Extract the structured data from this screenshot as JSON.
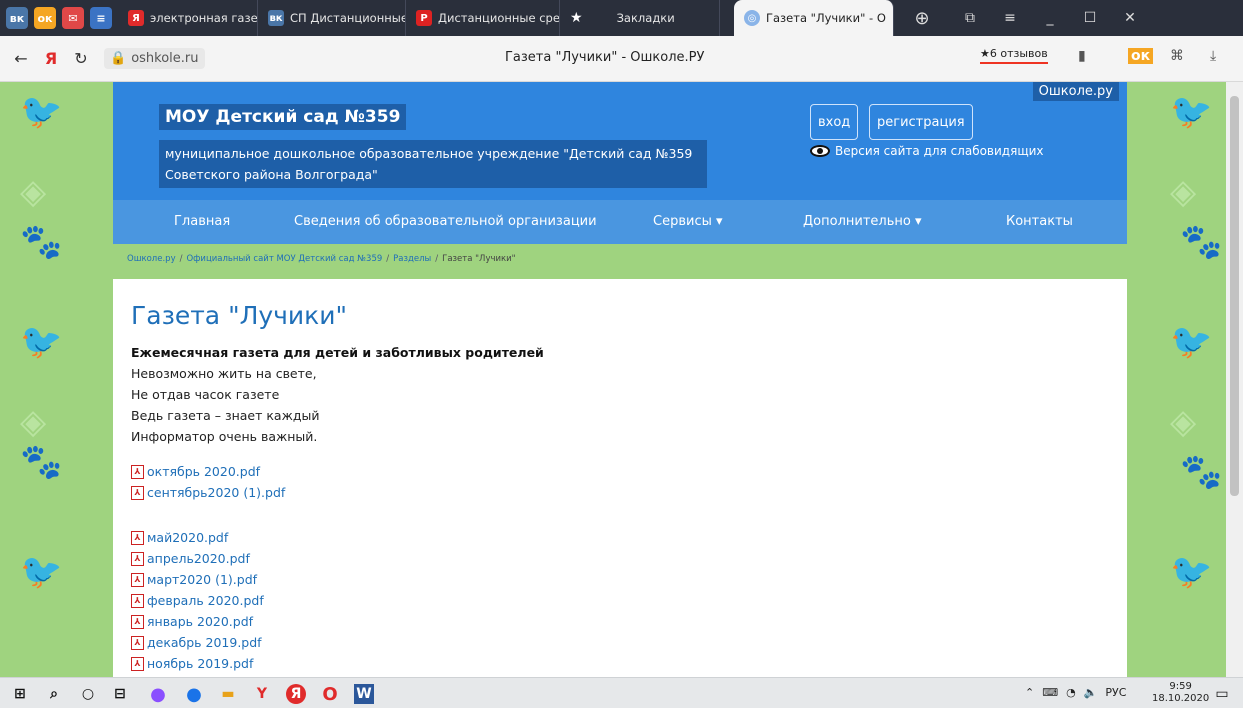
{
  "browser": {
    "tabs": [
      {
        "label": "электронная газета в д",
        "icon": "yandex-icon",
        "active": false
      },
      {
        "label": "СП Дистанционные фо",
        "icon": "vk-icon",
        "active": false
      },
      {
        "label": "Дистанционные средс",
        "icon": "pdf-icon",
        "active": false
      },
      {
        "label": "Закладки",
        "icon": "star-icon",
        "active": false
      },
      {
        "label": "Газета \"Лучики\" - О",
        "icon": "globe-icon",
        "active": true
      }
    ],
    "url": "oshkole.ru",
    "title": "Газета \"Лучики\" - Ошколе.РУ",
    "reviews": "★6 отзывов",
    "accent": "#2f85de"
  },
  "site": {
    "brand": "Ошколе.ру",
    "org_name": "МОУ Детский сад №359",
    "org_subtitle": "муниципальное дошкольное образовательное учреждение \"Детский сад №359 Советского района Волгограда\"",
    "login": "вход",
    "register": "регистрация",
    "low_vision": "Версия сайта для слабовидящих",
    "menu": [
      {
        "label": "Главная"
      },
      {
        "label": "Сведения об образовательной организации"
      },
      {
        "label": "Сервисы ▾"
      },
      {
        "label": "Дополнительно ▾"
      },
      {
        "label": "Контакты"
      }
    ],
    "breadcrumb": [
      "Ошколе.ру",
      "Официальный сайт МОУ Детский сад №359",
      "Разделы",
      "Газета \"Лучики\""
    ]
  },
  "content": {
    "heading": "Газета \"Лучики\"",
    "tagline": "Ежемесячная газета для детей и заботливых родителей",
    "poem": [
      "Невозможно жить на свете,",
      "Не отдав часок газете",
      "Ведь газета – знает каждый",
      "Информатор очень важный."
    ],
    "files_group1": [
      "октябрь 2020.pdf",
      "сентябрь2020 (1).pdf"
    ],
    "files_group2": [
      "май2020.pdf",
      "апрель2020.pdf",
      "март2020 (1).pdf",
      "февраль 2020.pdf",
      "январь 2020.pdf",
      "декабрь 2019.pdf",
      "ноябрь 2019.pdf"
    ]
  },
  "taskbar": {
    "lang": "РУС",
    "time": "9:59",
    "date": "18.10.2020"
  }
}
